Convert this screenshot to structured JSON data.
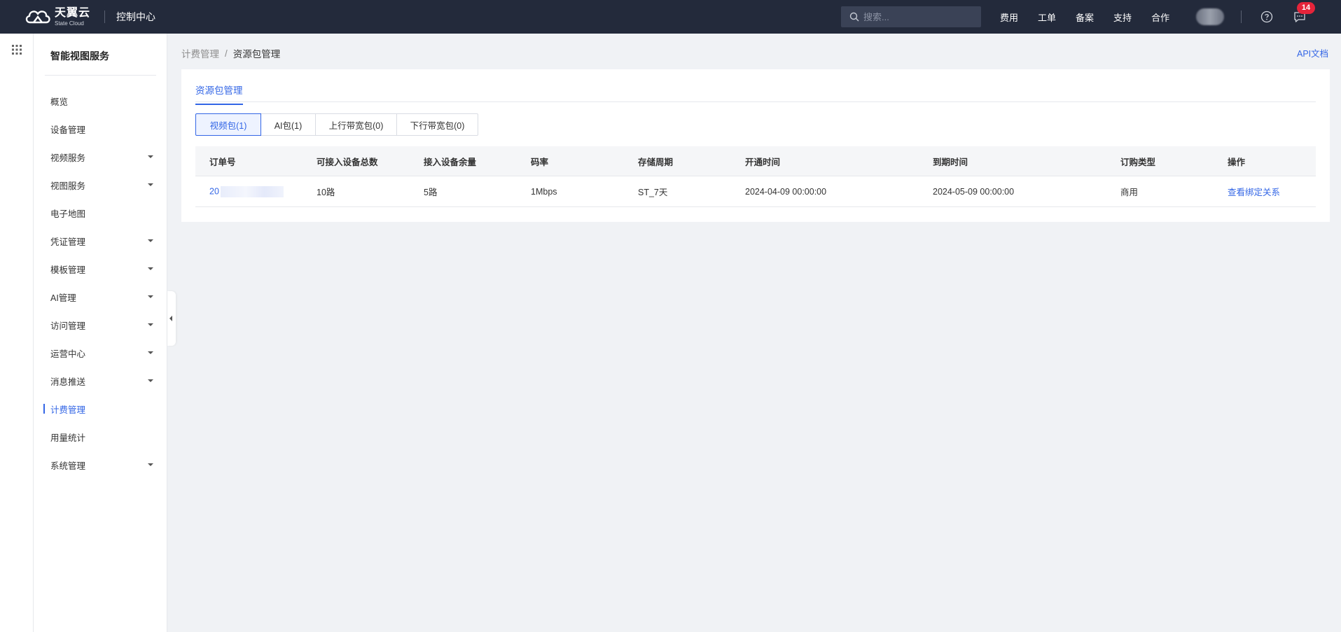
{
  "topbar": {
    "logo_cn": "天翼云",
    "logo_en": "State Cloud",
    "console_title": "控制中心",
    "search_placeholder": "搜索...",
    "links": [
      "费用",
      "工单",
      "备案",
      "支持",
      "合作"
    ],
    "message_count": "14"
  },
  "sidebar": {
    "title": "智能视图服务",
    "items": [
      {
        "label": "概览",
        "expandable": false
      },
      {
        "label": "设备管理",
        "expandable": false
      },
      {
        "label": "视频服务",
        "expandable": true
      },
      {
        "label": "视图服务",
        "expandable": true
      },
      {
        "label": "电子地图",
        "expandable": false
      },
      {
        "label": "凭证管理",
        "expandable": true
      },
      {
        "label": "模板管理",
        "expandable": true
      },
      {
        "label": "AI管理",
        "expandable": true
      },
      {
        "label": "访问管理",
        "expandable": true
      },
      {
        "label": "运营中心",
        "expandable": true
      },
      {
        "label": "消息推送",
        "expandable": true
      },
      {
        "label": "计费管理",
        "expandable": false,
        "active": true
      },
      {
        "label": "用量统计",
        "expandable": false
      },
      {
        "label": "系统管理",
        "expandable": true
      }
    ]
  },
  "breadcrumb": {
    "parent": "计费管理",
    "separator": "/",
    "current": "资源包管理"
  },
  "api_doc": "API文档",
  "card": {
    "tab": "资源包管理",
    "segments": [
      {
        "label": "视频包(1)",
        "active": true
      },
      {
        "label": "AI包(1)",
        "active": false
      },
      {
        "label": "上行带宽包(0)",
        "active": false
      },
      {
        "label": "下行带宽包(0)",
        "active": false
      }
    ],
    "table": {
      "columns": [
        "订单号",
        "可接入设备总数",
        "接入设备余量",
        "码率",
        "存储周期",
        "开通时间",
        "到期时间",
        "订购类型",
        "操作"
      ],
      "rows": [
        {
          "order_no": "20",
          "total_devices": "10路",
          "remaining": "5路",
          "bitrate": "1Mbps",
          "storage": "ST_7天",
          "start": "2024-04-09 00:00:00",
          "end": "2024-05-09 00:00:00",
          "type": "商用",
          "action": "查看绑定关系"
        }
      ]
    }
  },
  "colors": {
    "topbar_bg": "#232a3b",
    "accent": "#3366e6",
    "badge": "#e5243a",
    "page_bg": "#f0f2f5"
  }
}
